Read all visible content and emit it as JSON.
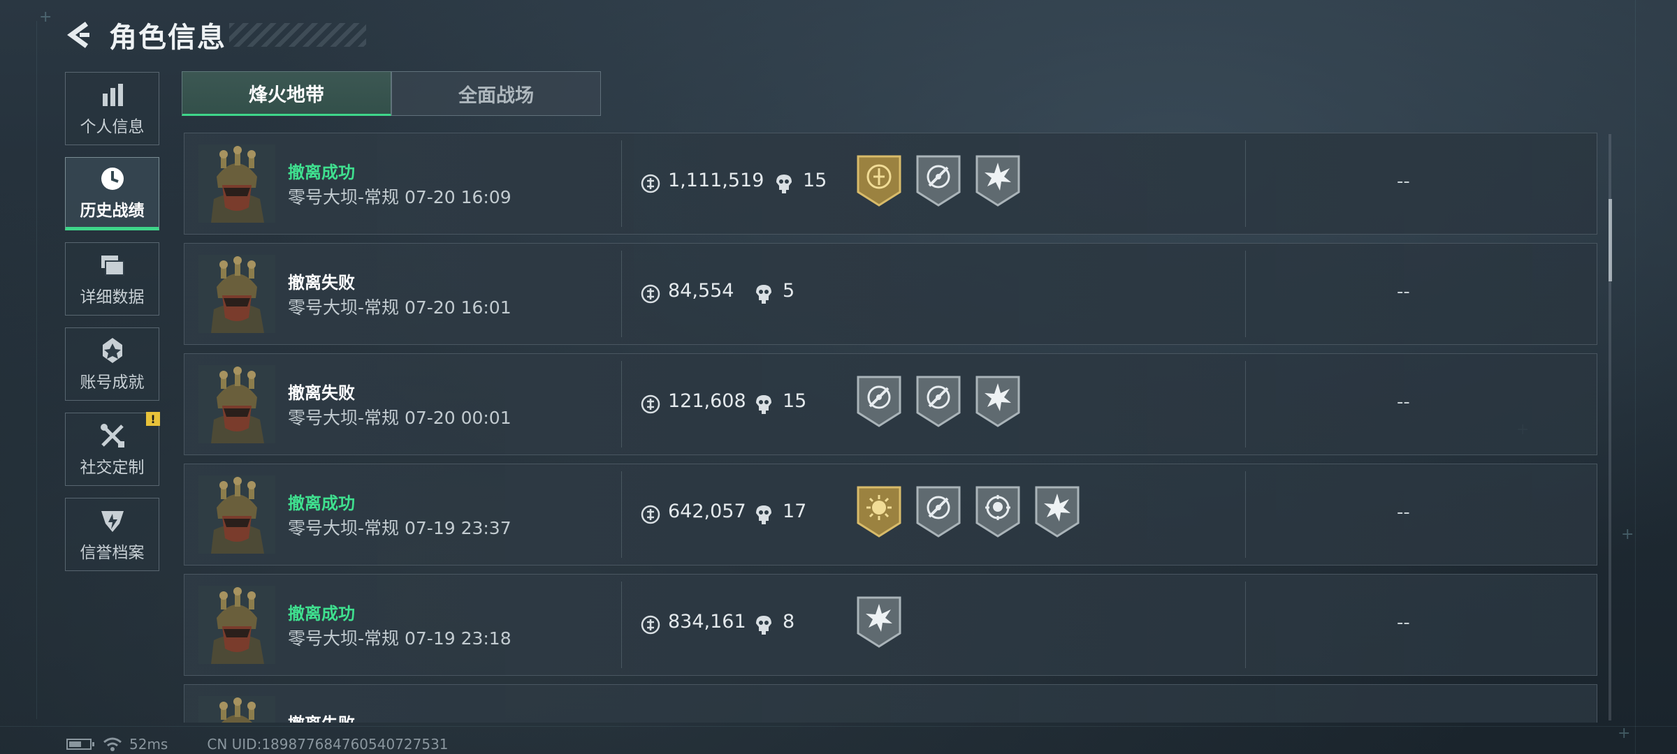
{
  "header": {
    "title": "角色信息"
  },
  "sidebar": {
    "items": [
      {
        "label": "个人信息",
        "icon": "bar-chart-icon",
        "active": false
      },
      {
        "label": "历史战绩",
        "icon": "clock-icon",
        "active": true
      },
      {
        "label": "详细数据",
        "icon": "folder-icon",
        "active": false
      },
      {
        "label": "账号成就",
        "icon": "medal-icon",
        "active": false
      },
      {
        "label": "社交定制",
        "icon": "tools-icon",
        "active": false,
        "alert": "!"
      },
      {
        "label": "信誉档案",
        "icon": "shield-icon",
        "active": false
      }
    ]
  },
  "tabs": [
    {
      "label": "烽火地带",
      "active": true
    },
    {
      "label": "全面战场",
      "active": false
    }
  ],
  "matches": [
    {
      "status": "撤离成功",
      "result": "success",
      "map": "零号大坝-常规",
      "time": "07-20 16:09",
      "value": "1,111,519",
      "kills": "15",
      "badges": [
        "gold-emblem-badge",
        "sniper-scope-badge",
        "explosion-badge"
      ],
      "extra": "--"
    },
    {
      "status": "撤离失败",
      "result": "fail",
      "map": "零号大坝-常规",
      "time": "07-20 16:01",
      "value": "84,554",
      "kills": "5",
      "badges": [],
      "extra": "--"
    },
    {
      "status": "撤离失败",
      "result": "fail",
      "map": "零号大坝-常规",
      "time": "07-20 00:01",
      "value": "121,608",
      "kills": "15",
      "badges": [
        "sniper-scope-badge",
        "sniper-scope-badge",
        "explosion-badge"
      ],
      "extra": "--"
    },
    {
      "status": "撤离成功",
      "result": "success",
      "map": "零号大坝-常规",
      "time": "07-19 23:37",
      "value": "642,057",
      "kills": "17",
      "badges": [
        "gold-sun-badge",
        "sniper-scope-badge",
        "target-skull-badge",
        "explosion-badge"
      ],
      "extra": "--"
    },
    {
      "status": "撤离成功",
      "result": "success",
      "map": "零号大坝-常规",
      "time": "07-19 23:18",
      "value": "834,161",
      "kills": "8",
      "badges": [
        "explosion-badge"
      ],
      "extra": "--"
    },
    {
      "status": "撤离失败",
      "result": "fail",
      "map": "",
      "time": "",
      "value": "",
      "kills": "",
      "badges": [],
      "extra": ""
    }
  ],
  "footer": {
    "ping": "52ms",
    "uid": "CN UID:1898776847605407​27531",
    "battery_level": 0.6
  },
  "colors": {
    "accent": "#3fd68a",
    "success": "#3fe08f",
    "alert": "#e8c23a",
    "gold": "#b99a4a",
    "badge_gray": "#6f7a80"
  }
}
